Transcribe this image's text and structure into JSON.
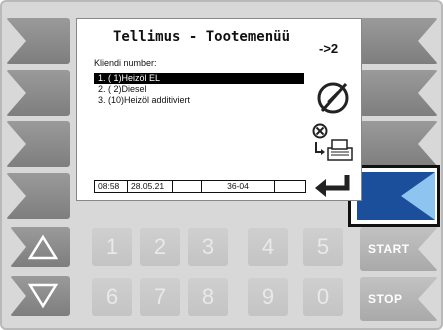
{
  "screen": {
    "title": "Tellimus - Tootemenüü",
    "page_indicator": "->2",
    "field_label": "Kliendi number:",
    "items": [
      {
        "label": "1.  ( 1)Heizöl EL",
        "selected": true
      },
      {
        "label": "2.  ( 2)Diesel",
        "selected": false
      },
      {
        "label": "3.  (10)Heizöl additiviert",
        "selected": false
      }
    ],
    "status": {
      "time": "08:58",
      "date": "28.05.21",
      "field3": "",
      "code": "36-04",
      "field5": ""
    }
  },
  "keypad": {
    "row1": [
      "1",
      "2",
      "3",
      "4",
      "5"
    ],
    "row2": [
      "6",
      "7",
      "8",
      "9",
      "0"
    ]
  },
  "right_keys": {
    "start_label": "START",
    "stop_label": "STOP"
  },
  "colors": {
    "accent": "#1b4f9c",
    "accent_light": "#8ec4f0",
    "key_gray": "#8a8a8a"
  }
}
